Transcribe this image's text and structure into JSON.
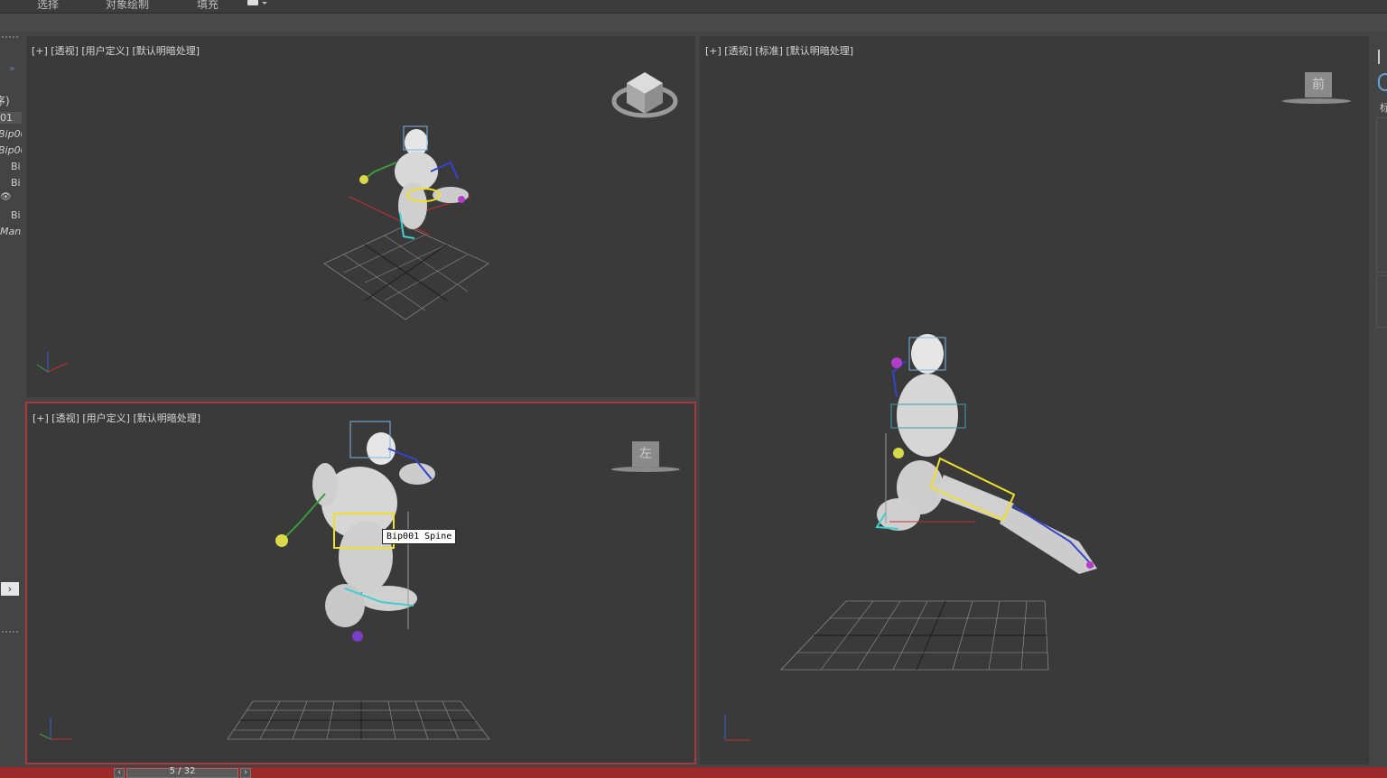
{
  "menu": [
    "选择",
    "对象绘制",
    "填充"
  ],
  "left_panel": {
    "expand_arrows": "»",
    "rows": [
      "序)",
      "01",
      "Bip00",
      "Bip00",
      "Bi",
      "Bi",
      "",
      "Bi",
      "Mani"
    ]
  },
  "viewports": {
    "top_left": {
      "label": "[+] [透视] [用户定义] [默认明暗处理]"
    },
    "bottom_left": {
      "label": "[+] [透视] [用户定义] [默认明暗处理]",
      "viewcube_face": "左"
    },
    "right": {
      "label": "[+] [透视] [标准] [默认明暗处理]",
      "viewcube_face": "前"
    }
  },
  "tooltip": "Bip001 Spine",
  "time_slider": {
    "label": "5 / 32"
  },
  "colors": {
    "active_border": "#a83a3a",
    "bottom_bar": "#9c2a2a",
    "viewport_bg": "#3a3a3a"
  }
}
